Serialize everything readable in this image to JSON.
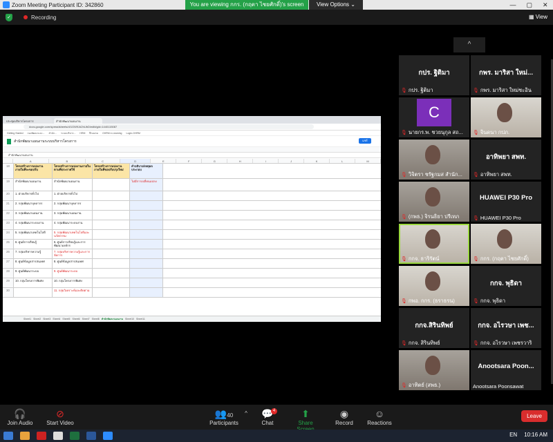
{
  "window": {
    "title": "Zoom Meeting Participant ID: 342860",
    "viewing_banner": "You are viewing กกร. (กฤตา ไชยศักดิ์)'s screen",
    "view_options": "View Options ⌄",
    "controls": [
      "—",
      "▢",
      "✕"
    ]
  },
  "topbar": {
    "recording_label": "Recording",
    "view_label": "View"
  },
  "shared_screen": {
    "tabs": [
      "ประชุมบริหารโครงการ",
      "สำนักพัฒนาแผนงาน"
    ],
    "url": "docs.google.com/spreadsheets/d/1GW9Jd2hUbD/edit#gid=1440115087",
    "bookmarks": [
      "Getting Started",
      "กองพัฒนาและ...",
      "สำนัก...",
      "ระบบบริหาร...",
      "HRM",
      "ฝึกอบรม",
      "GHRM e-Learning",
      "Login-GHRM"
    ],
    "sheet_title": "สำนักพัฒนาแผนงานระบบบริหารโครงการ",
    "share_label": "แชร์",
    "formula": "สำนักพัฒนาแผนงาน",
    "col_letters": [
      "A",
      "B",
      "C",
      "D",
      "E",
      "F",
      "G",
      "H",
      "I",
      "J",
      "K",
      "L",
      "M"
    ],
    "header_row": {
      "num": "18",
      "a": "โครงสร้างการแบ่งงานภายในที่จะขอปรับ",
      "b": "โครงสร้างการแบ่งงานภายในตามที่ประกาศใช้",
      "c": "โครงสร้างการแบ่งงานภายในที่ขอปรับปรุงใหม่",
      "d": "คำอธิบาย/เหตุผลประกอบ"
    },
    "rows": [
      {
        "num": "19",
        "a": "สำนักพัฒนาแผนงาน",
        "b": "สำนักพัฒนาแผนงาน",
        "c": "",
        "d": "ไม่มีการเปลี่ยนแปลง",
        "d_red": true
      },
      {
        "num": "20",
        "a": "1. ฝ่ายบริหารทั่วไป",
        "b": "1. ฝ่ายบริหารทั่วไป",
        "c": "",
        "d": "",
        "d_red": false
      },
      {
        "num": "21",
        "a": "2. กลุ่มพัฒนาบุคลากร",
        "b": "2. กลุ่มพัฒนาบุคลากร",
        "c": "",
        "d": "",
        "d_red": false
      },
      {
        "num": "22",
        "a": "3. กลุ่มพัฒนาแผนงาน",
        "b": "3. กลุ่มพัฒนาแผนงาน",
        "c": "",
        "d": "",
        "d_red": false
      },
      {
        "num": "23",
        "a": "4. กลุ่มพัฒนาระบบงาน",
        "b": "4. กลุ่มพัฒนาระบบงาน",
        "c": "",
        "d": "",
        "d_red": false
      },
      {
        "num": "24",
        "a": "5. กลุ่มพัฒนาเทคโนโลยี",
        "b": "5. กลุ่มพัฒนาเทคโนโลยีและนวัตกรรม",
        "c": "",
        "d": "",
        "d_red": false
      },
      {
        "num": "25",
        "a": "6. ศูนย์การเรียนรู้",
        "b": "6. ศูนย์การเรียนรู้และการพัฒนาองค์กร",
        "c": "",
        "d": "",
        "d_red": false
      },
      {
        "num": "26",
        "a": "7. กลุ่มบริหารความรู้",
        "b": "7. กลุ่มบริหารความรู้และการจัดการ",
        "c": "",
        "d": "",
        "d_red": false
      },
      {
        "num": "27",
        "a": "8. ศูนย์ข้อมูลสารสนเทศ",
        "b": "8. ศูนย์ข้อมูลสารสนเทศ",
        "c": "",
        "d": "",
        "d_red": false
      },
      {
        "num": "28",
        "a": "9. ศูนย์พัฒนาระบบ",
        "b": "9. ศูนย์พัฒนาระบบ",
        "c": "",
        "d": "",
        "d_red": false
      },
      {
        "num": "29",
        "a": "10. กลุ่มโครงการพิเศษ",
        "b": "10. กลุ่มโครงการพิเศษ",
        "c": "",
        "d": "",
        "d_red": false
      },
      {
        "num": "30",
        "a": "",
        "b": "11. กลุ่มวิเคราะห์และติดตาม",
        "c": "",
        "d": "",
        "d_red": false
      }
    ],
    "sheet_tabs": [
      "Sheet1",
      "Sheet2",
      "Sheet3",
      "Sheet4",
      "Sheet5",
      "Sheet6",
      "Sheet7",
      "Sheet8",
      "สำนักพัฒนาแผนงาน",
      "Sheet10",
      "Sheet11"
    ]
  },
  "panel": {
    "collapse_icon": "^",
    "tiles": [
      {
        "name": "กปร. ฐิติมา",
        "label": "กปร. ฐิติมา",
        "kind": "name"
      },
      {
        "name": "กพร. มาริสา ใหม่...",
        "label": "กพร. มาริสา ใหม่ชะอิน",
        "kind": "name"
      },
      {
        "name": "",
        "label": "นายกร.พ. ชวยนุกุล สถ...",
        "kind": "avatar",
        "avatar_letter": "C"
      },
      {
        "name": "",
        "label": "จินดนา กปภ.",
        "kind": "video_light"
      },
      {
        "name": "",
        "label": "วิจิตรา ชรัฐกมส สำนัก...",
        "kind": "video"
      },
      {
        "name": "อาทิพยา สพท.",
        "label": "อาทิพยา สพท.",
        "kind": "name"
      },
      {
        "name": "",
        "label": "(กพธ.) จิรนธิยา ปรีเทภ",
        "kind": "video"
      },
      {
        "name": "HUAWEI P30 Pro",
        "label": "HUAWEI P30 Pro",
        "kind": "name"
      },
      {
        "name": "",
        "label": "กกจ. ธาริรัตน์",
        "kind": "video_active"
      },
      {
        "name": "",
        "label": "กกร. (กฤตา ไชยศักดิ์)",
        "kind": "video_light"
      },
      {
        "name": "",
        "label": "กพอ. กกร. (ธราธรน)",
        "kind": "video_light"
      },
      {
        "name": "กกจ. พุธิดา",
        "label": "กกจ. พุธิดา",
        "kind": "name"
      },
      {
        "name": "กกจ.สิรินทิพย์",
        "label": "กกจ. สิรินทิพย์",
        "kind": "name"
      },
      {
        "name": "กกจ. อไรวษา เพช...",
        "label": "กกจ. อไรวษา เพชรวาริ",
        "kind": "name"
      },
      {
        "name": "",
        "label": "อาทิตย์ (สพธ.)",
        "kind": "video"
      },
      {
        "name": "Anootsara Poon...",
        "label": "Anootsara Poonsawat",
        "kind": "name_nomic"
      }
    ]
  },
  "bottom": {
    "join_audio": "Join Audio",
    "start_video": "Start Video",
    "participants": "Participants",
    "participants_count": "40",
    "chat": "Chat",
    "chat_badge": "4",
    "share_screen": "Share Screen",
    "record": "Record",
    "reactions": "Reactions",
    "leave": "Leave"
  },
  "taskbar": {
    "lang": "EN",
    "time": "10:16 AM"
  },
  "colors": {
    "zoom_green": "#24a148",
    "leave_red": "#d92d2d",
    "active_outline": "#9ad83e",
    "avatar_purple": "#7b2fb9"
  }
}
